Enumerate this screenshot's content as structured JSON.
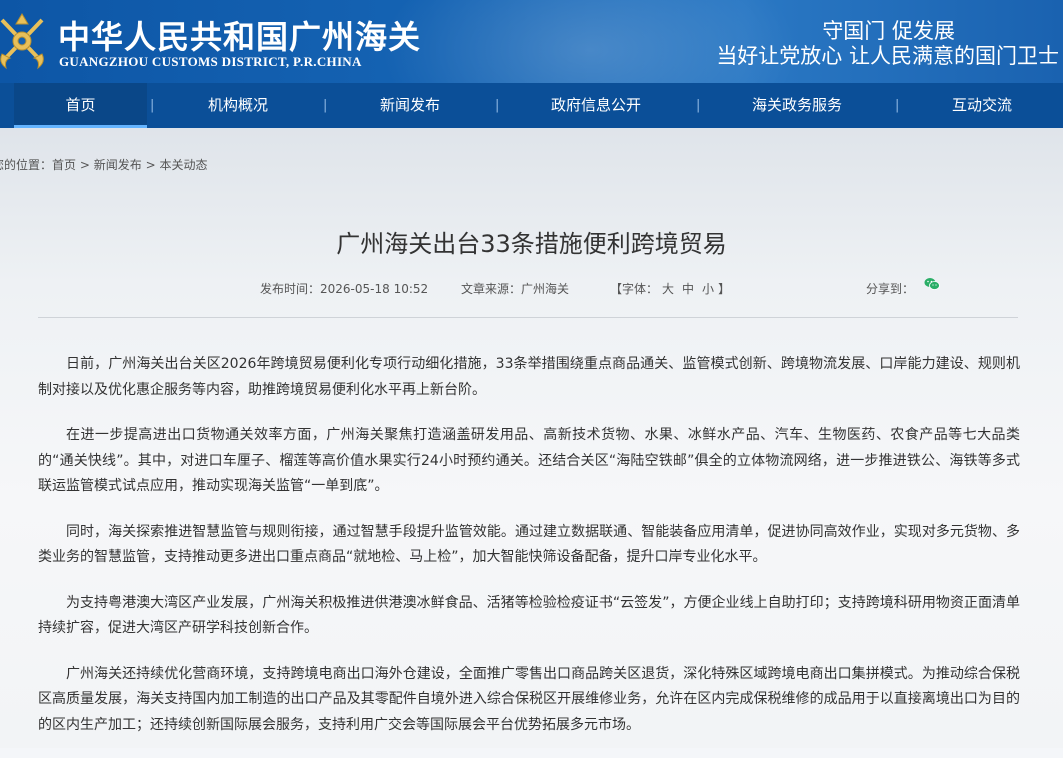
{
  "header": {
    "title_cn": "中华人民共和国广州海关",
    "title_en": "GUANGZHOU CUSTOMS DISTRICT, P.R.CHINA",
    "slogan_line1": "守国门  促发展",
    "slogan_line2": "当好让党放心  让人民满意的国门卫士"
  },
  "nav": {
    "items": [
      {
        "label": "首页"
      },
      {
        "label": "机构概况"
      },
      {
        "label": "新闻发布"
      },
      {
        "label": "政府信息公开"
      },
      {
        "label": "海关政务服务"
      },
      {
        "label": "互动交流"
      }
    ],
    "separator": "|"
  },
  "breadcrumb": {
    "prefix": "您的位置：",
    "items": [
      "首页",
      "新闻发布",
      "本关动态"
    ],
    "separator": ">"
  },
  "article": {
    "title": "广州海关出台33条措施便利跨境贸易",
    "publish_label": "发布时间：",
    "publish_time": "2026-05-18 10:52",
    "source_label": "文章来源：",
    "source": "广州海关",
    "font_label_open": "【字体：",
    "font_large": "大",
    "font_medium": "中",
    "font_small": "小",
    "font_label_close": "】",
    "share_label": "分享到：",
    "share_icon": "wechat-icon",
    "paragraphs": [
      "日前，广州海关出台关区2026年跨境贸易便利化专项行动细化措施，33条举措围绕重点商品通关、监管模式创新、跨境物流发展、口岸能力建设、规则机制对接以及优化惠企服务等内容，助推跨境贸易便利化水平再上新台阶。",
      "在进一步提高进出口货物通关效率方面，广州海关聚焦打造涵盖研发用品、高新技术货物、水果、冰鲜水产品、汽车、生物医药、农食产品等七大品类的“通关快线”。其中，对进口车厘子、榴莲等高价值水果实行24小时预约通关。还结合关区“海陆空铁邮”俱全的立体物流网络，进一步推进铁公、海铁等多式联运监管模式试点应用，推动实现海关监管“一单到底”。",
      "同时，海关探索推进智慧监管与规则衔接，通过智慧手段提升监管效能。通过建立数据联通、智能装备应用清单，促进协同高效作业，实现对多元货物、多类业务的智慧监管，支持推动更多进出口重点商品“就地检、马上检”，加大智能快筛设备配备，提升口岸专业化水平。",
      "为支持粤港澳大湾区产业发展，广州海关积极推进供港澳冰鲜食品、活猪等检验检疫证书“云签发”，方便企业线上自助打印；支持跨境科研用物资正面清单持续扩容，促进大湾区产研学科技创新合作。",
      "广州海关还持续优化营商环境，支持跨境电商出口海外仓建设，全面推广零售出口商品跨关区退货，深化特殊区域跨境电商出口集拼模式。为推动综合保税区高质量发展，海关支持国内加工制造的出口产品及其零配件自境外进入综合保税区开展维修业务，允许在区内完成保税维修的成品用于以直接离境出口为目的的区内生产加工；还持续创新国际展会服务，支持利用广交会等国际展会平台优势拓展多元市场。"
    ]
  },
  "colors": {
    "header_blue": "#0d56a6",
    "nav_blue": "#0b4f98",
    "active_underline": "#64b4ff"
  }
}
